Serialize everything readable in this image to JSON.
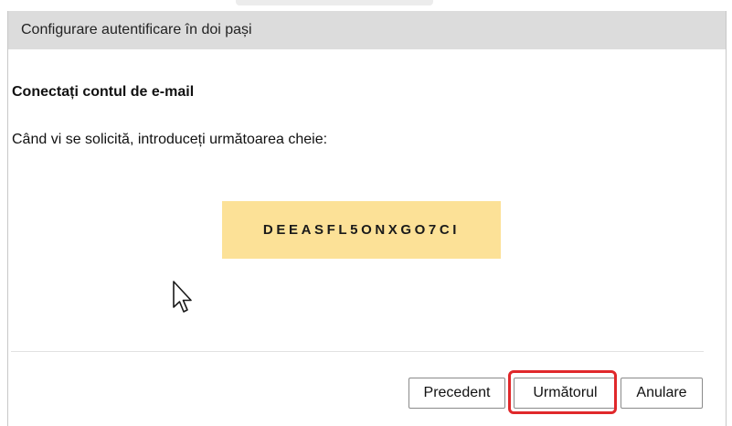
{
  "dialog": {
    "title": "Configurare autentificare în doi pași",
    "heading": "Conectați contul de e-mail",
    "instruction": "Când vi se solicită, introduceți următoarea cheie:",
    "secret_key": "DEEASFL5ONXGO7CI"
  },
  "buttons": {
    "previous_label": "Precedent",
    "next_label": "Următorul",
    "cancel_label": "Anulare"
  },
  "colors": {
    "key_background": "#fce197",
    "titlebar_background": "#dcdcdc",
    "highlight_border": "#e0282b"
  },
  "icons": {
    "cursor": "mouse-pointer-icon"
  }
}
